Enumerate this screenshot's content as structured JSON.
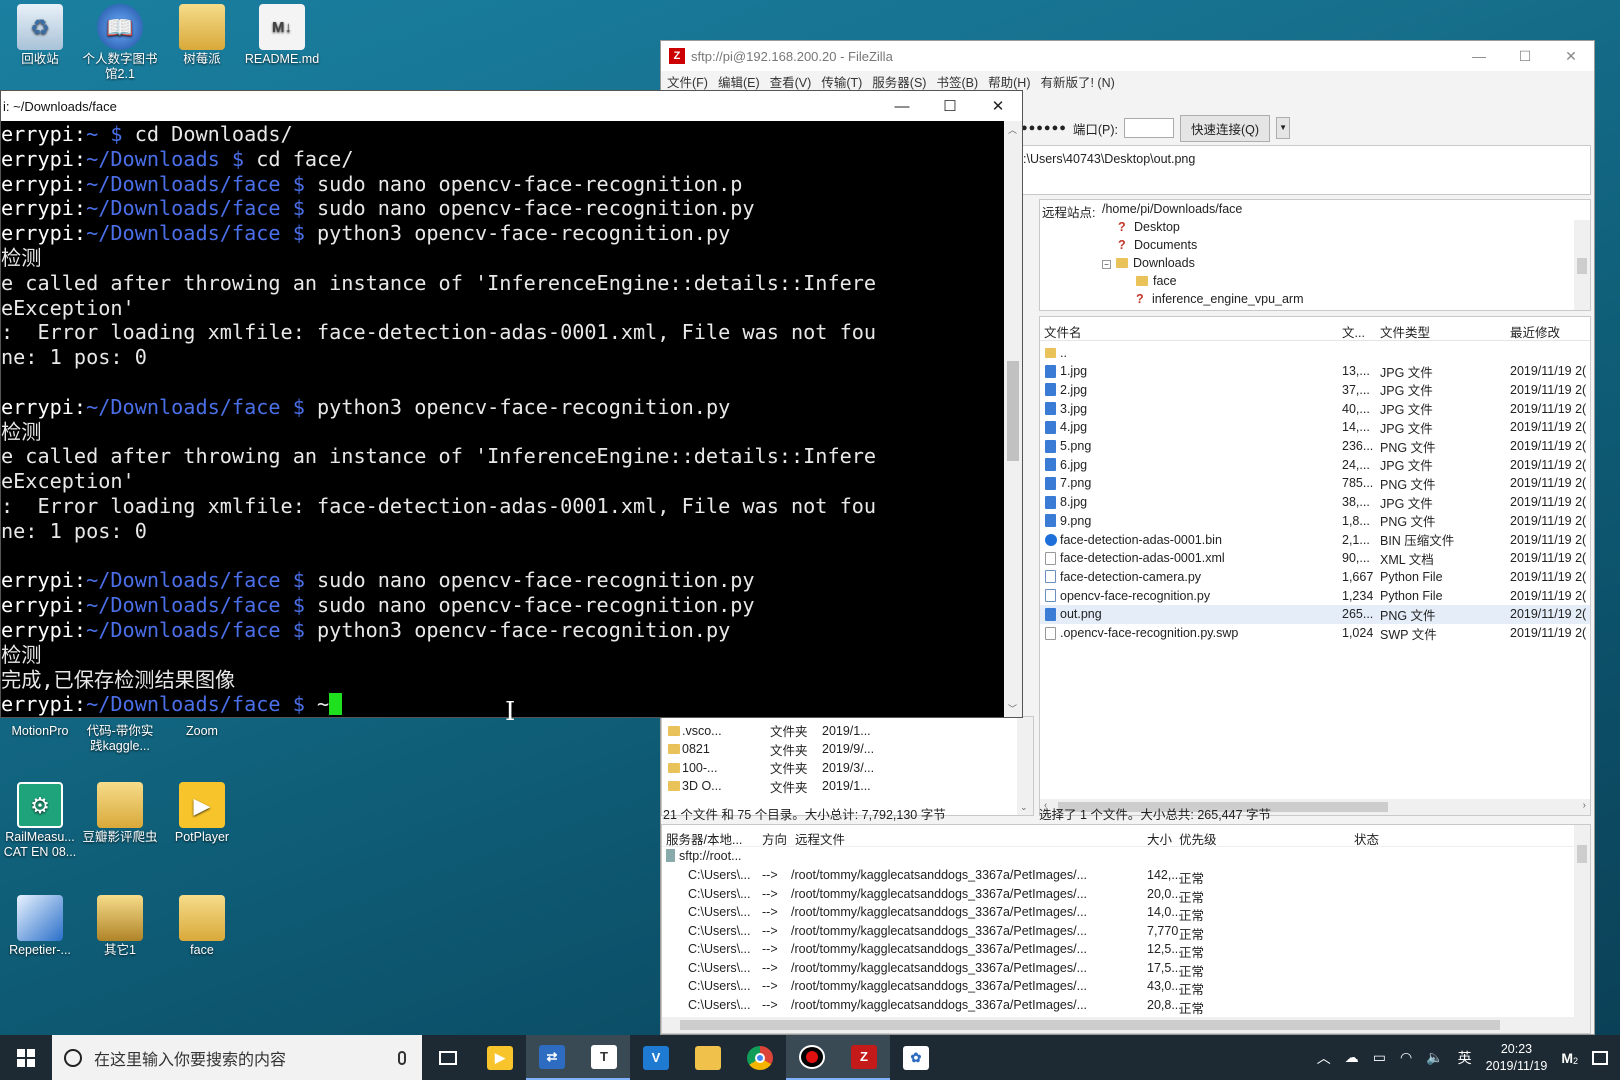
{
  "desktop": {
    "top_icons": [
      {
        "label": "回收站"
      },
      {
        "label": "个人数字图书馆2.1"
      },
      {
        "label": "树莓派"
      },
      {
        "label": "README.md"
      }
    ],
    "lower_icons": [
      {
        "label": "MotionPro"
      },
      {
        "label": "代码-带你实践kaggle..."
      },
      {
        "label": "Zoom"
      },
      {
        "label": "RailMeasu... CAT EN 08..."
      },
      {
        "label": "豆瓣影评爬虫"
      },
      {
        "label": "PotPlayer"
      },
      {
        "label": "Repetier-..."
      },
      {
        "label": "其它1"
      },
      {
        "label": "face"
      }
    ]
  },
  "terminal": {
    "title": "i: ~/Downloads/face",
    "lines": [
      {
        "host": "errypi:",
        "path": "~ $",
        "cmd": " cd Downloads/"
      },
      {
        "host": "errypi:",
        "path": "~/Downloads $",
        "cmd": " cd face/"
      },
      {
        "host": "errypi:",
        "path": "~/Downloads/face $",
        "cmd": " sudo nano opencv-face-recognition.p"
      },
      {
        "host": "errypi:",
        "path": "~/Downloads/face $",
        "cmd": " sudo nano opencv-face-recognition.py"
      },
      {
        "host": "errypi:",
        "path": "~/Downloads/face $",
        "cmd": " python3 opencv-face-recognition.py"
      },
      {
        "text": "检测"
      },
      {
        "text": "e called after throwing an instance of 'InferenceEngine::details::Infere"
      },
      {
        "text": "eException'"
      },
      {
        "text": ":  Error loading xmlfile: face-detection-adas-0001.xml, File was not fou"
      },
      {
        "text": "ne: 1 pos: 0"
      },
      {
        "text": ""
      },
      {
        "host": "errypi:",
        "path": "~/Downloads/face $",
        "cmd": " python3 opencv-face-recognition.py"
      },
      {
        "text": "检测"
      },
      {
        "text": "e called after throwing an instance of 'InferenceEngine::details::Infere"
      },
      {
        "text": "eException'"
      },
      {
        "text": ":  Error loading xmlfile: face-detection-adas-0001.xml, File was not fou"
      },
      {
        "text": "ne: 1 pos: 0"
      },
      {
        "text": ""
      },
      {
        "host": "errypi:",
        "path": "~/Downloads/face $",
        "cmd": " sudo nano opencv-face-recognition.py"
      },
      {
        "host": "errypi:",
        "path": "~/Downloads/face $",
        "cmd": " sudo nano opencv-face-recognition.py"
      },
      {
        "host": "errypi:",
        "path": "~/Downloads/face $",
        "cmd": " python3 opencv-face-recognition.py"
      },
      {
        "text": "检测"
      },
      {
        "text": "完成,已保存检测结果图像"
      },
      {
        "host": "errypi:",
        "path": "~/Downloads/face $",
        "cmd": " ~",
        "cursor": true
      }
    ]
  },
  "filezilla": {
    "title": "sftp://pi@192.168.200.20 - FileZilla",
    "menu": [
      "文件(F)",
      "编辑(E)",
      "查看(V)",
      "传输(T)",
      "服务器(S)",
      "书签(B)",
      "帮助(H)",
      "有新版了! (N)"
    ],
    "password_mask": "●●●●●●",
    "port_label": "端口(P):",
    "quickconnect_label": "快速连接(Q)",
    "log_line": ":\\Users\\40743\\Desktop\\out.png",
    "remote_site_label": "远程站点:",
    "remote_path": "/home/pi/Downloads/face",
    "tree": [
      {
        "label": "Desktop",
        "kind": "q"
      },
      {
        "label": "Documents",
        "kind": "q"
      },
      {
        "label": "Downloads",
        "kind": "folder"
      },
      {
        "label": "face",
        "kind": "folder"
      },
      {
        "label": "inference_engine_vpu_arm",
        "kind": "q"
      }
    ],
    "columns": {
      "name": "文件名",
      "size": "文...",
      "type": "文件类型",
      "modified": "最近修改"
    },
    "files": [
      {
        "name": "..",
        "size": "",
        "type": "",
        "date": "",
        "icon": "folder"
      },
      {
        "name": "1.jpg",
        "size": "13,...",
        "type": "JPG 文件",
        "date": "2019/11/19 2(",
        "icon": "img"
      },
      {
        "name": "2.jpg",
        "size": "37,...",
        "type": "JPG 文件",
        "date": "2019/11/19 2(",
        "icon": "img"
      },
      {
        "name": "3.jpg",
        "size": "40,...",
        "type": "JPG 文件",
        "date": "2019/11/19 2(",
        "icon": "img"
      },
      {
        "name": "4.jpg",
        "size": "14,...",
        "type": "JPG 文件",
        "date": "2019/11/19 2(",
        "icon": "img"
      },
      {
        "name": "5.png",
        "size": "236...",
        "type": "PNG 文件",
        "date": "2019/11/19 2(",
        "icon": "img"
      },
      {
        "name": "6.jpg",
        "size": "24,...",
        "type": "JPG 文件",
        "date": "2019/11/19 2(",
        "icon": "img"
      },
      {
        "name": "7.png",
        "size": "785...",
        "type": "PNG 文件",
        "date": "2019/11/19 2(",
        "icon": "img"
      },
      {
        "name": "8.jpg",
        "size": "38,...",
        "type": "JPG 文件",
        "date": "2019/11/19 2(",
        "icon": "img"
      },
      {
        "name": "9.png",
        "size": "1,8...",
        "type": "PNG 文件",
        "date": "2019/11/19 2(",
        "icon": "img"
      },
      {
        "name": "face-detection-adas-0001.bin",
        "size": "2,1...",
        "type": "BIN 压缩文件",
        "date": "2019/11/19 2(",
        "icon": "bin"
      },
      {
        "name": "face-detection-adas-0001.xml",
        "size": "90,...",
        "type": "XML 文档",
        "date": "2019/11/19 2(",
        "icon": "doc"
      },
      {
        "name": "face-detection-camera.py",
        "size": "1,667",
        "type": "Python File",
        "date": "2019/11/19 2(",
        "icon": "py"
      },
      {
        "name": "opencv-face-recognition.py",
        "size": "1,234",
        "type": "Python File",
        "date": "2019/11/19 2(",
        "icon": "py"
      },
      {
        "name": "out.png",
        "size": "265...",
        "type": "PNG 文件",
        "date": "2019/11/19 2(",
        "icon": "img",
        "selected": true
      },
      {
        "name": ".opencv-face-recognition.py.swp",
        "size": "1,024",
        "type": "SWP 文件",
        "date": "2019/11/19 2(",
        "icon": "doc"
      }
    ],
    "local_files": [
      {
        "name": ".vsco...",
        "type": "文件夹",
        "date": "2019/1..."
      },
      {
        "name": "0821",
        "type": "文件夹",
        "date": "2019/9/..."
      },
      {
        "name": "100-...",
        "type": "文件夹",
        "date": "2019/3/..."
      },
      {
        "name": "3D O...",
        "type": "文件夹",
        "date": "2019/1..."
      }
    ],
    "local_status": "21 个文件 和 75 个目录。大小总计: 7,792,130 字节",
    "remote_status": "选择了 1 个文件。大小总共: 265,447 字节",
    "queue_columns": {
      "server": "服务器/本地...",
      "direction": "方向",
      "remote": "远程文件",
      "size": "大小",
      "priority": "优先级",
      "status": "状态"
    },
    "queue_server": "sftp://root...",
    "queue": [
      {
        "local": "C:\\Users\\...",
        "dir": "-->",
        "remote": "/root/tommy/kagglecatsanddogs_3367a/PetImages/...",
        "size": "142,...",
        "status": "正常"
      },
      {
        "local": "C:\\Users\\...",
        "dir": "-->",
        "remote": "/root/tommy/kagglecatsanddogs_3367a/PetImages/...",
        "size": "20,0...",
        "status": "正常"
      },
      {
        "local": "C:\\Users\\...",
        "dir": "-->",
        "remote": "/root/tommy/kagglecatsanddogs_3367a/PetImages/...",
        "size": "14,0...",
        "status": "正常"
      },
      {
        "local": "C:\\Users\\...",
        "dir": "-->",
        "remote": "/root/tommy/kagglecatsanddogs_3367a/PetImages/...",
        "size": "7,770",
        "status": "正常"
      },
      {
        "local": "C:\\Users\\...",
        "dir": "-->",
        "remote": "/root/tommy/kagglecatsanddogs_3367a/PetImages/...",
        "size": "12,5...",
        "status": "正常"
      },
      {
        "local": "C:\\Users\\...",
        "dir": "-->",
        "remote": "/root/tommy/kagglecatsanddogs_3367a/PetImages/...",
        "size": "17,5...",
        "status": "正常"
      },
      {
        "local": "C:\\Users\\...",
        "dir": "-->",
        "remote": "/root/tommy/kagglecatsanddogs_3367a/PetImages/...",
        "size": "43,0...",
        "status": "正常"
      },
      {
        "local": "C:\\Users\\...",
        "dir": "-->",
        "remote": "/root/tommy/kagglecatsanddogs_3367a/PetImages/...",
        "size": "20,8...",
        "status": "正常"
      }
    ]
  },
  "taskbar": {
    "search_placeholder": "在这里输入你要搜索的内容",
    "time": "20:23",
    "date": "2019/11/19",
    "ime": "英",
    "apps": [
      "task-view",
      "potplayer",
      "network",
      "typora",
      "vscode",
      "explorer",
      "chrome",
      "record",
      "filezilla",
      "app"
    ],
    "notification_count": "2"
  },
  "colors": {
    "terminal_bg": "#000000",
    "prompt_path": "#4a6fe8",
    "cursor": "#1ee01e",
    "taskbar_bg": "#1d2a33"
  }
}
